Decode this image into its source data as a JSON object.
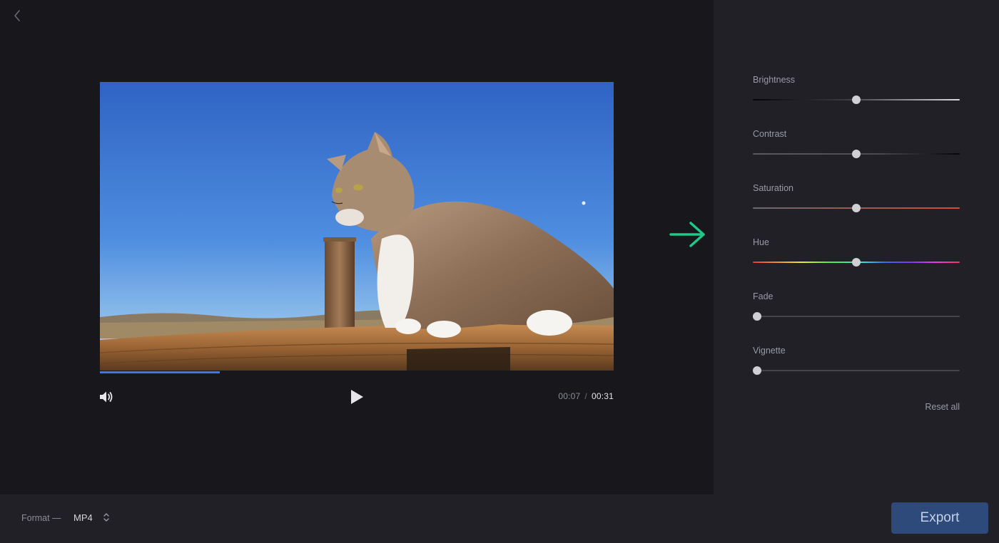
{
  "player": {
    "current_time": "00:07",
    "separator": "/",
    "total_time": "00:31",
    "progress": 0.233
  },
  "adjustments": [
    {
      "label": "Brightness",
      "value": 0.5,
      "track": "linear-gradient(90deg,#050506 0%,#3a3a40 45%,#d8d8dc 100%)"
    },
    {
      "label": "Contrast",
      "value": 0.5,
      "track": "linear-gradient(90deg,#5a5a60 0%,#4a4a50 60%,#050506 100%)"
    },
    {
      "label": "Saturation",
      "value": 0.5,
      "track": "linear-gradient(90deg,#6a6a70 0%,#9a5a50 55%,#d84a3a 100%)"
    },
    {
      "label": "Hue",
      "value": 0.5,
      "track": "linear-gradient(90deg,#e83a3a 0%,#e8a03a 14%,#e8e83a 24%,#4ae84a 38%,#3ae8d8 52%,#3a6ae8 64%,#7a3ae8 76%,#e83ae8 88%,#e83a5a 100%)"
    },
    {
      "label": "Fade",
      "value": 0.02,
      "track": "#45454c"
    },
    {
      "label": "Vignette",
      "value": 0.02,
      "track": "#45454c"
    }
  ],
  "panel": {
    "reset_label": "Reset all"
  },
  "footer": {
    "format_label": "Format —",
    "format_value": "MP4",
    "export_label": "Export"
  },
  "colors": {
    "accent_arrow": "#1fc98a",
    "progress": "#3a7be0",
    "export_bg": "#2d4a7a"
  }
}
